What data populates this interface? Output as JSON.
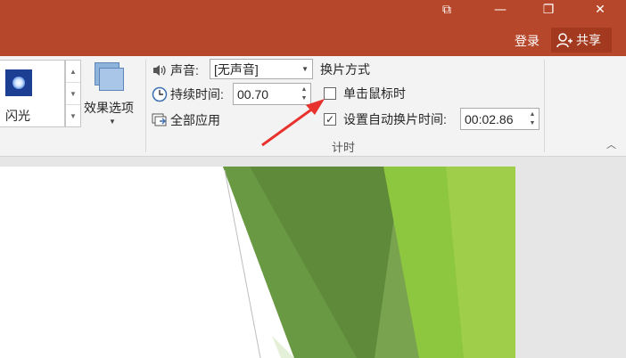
{
  "window_controls": {
    "restore_tab_glyph": "⧉",
    "minimize_glyph": "—",
    "maximize_glyph": "❐",
    "close_glyph": "✕"
  },
  "account": {
    "login": "登录",
    "share": "共享"
  },
  "transitions": {
    "selected_effect": "闪光",
    "effect_options": "效果选项"
  },
  "timing": {
    "sound_label": "声音:",
    "sound_value": "[无声音]",
    "duration_label": "持续时间:",
    "duration_value": "00.70",
    "apply_all": "全部应用",
    "advance_title": "换片方式",
    "on_click_label": "单击鼠标时",
    "on_click_checked": false,
    "after_label": "设置自动换片时间:",
    "after_checked": true,
    "after_value": "00:02.86",
    "group_label": "计时"
  },
  "colors": {
    "titlebar": "#b7472a",
    "share_bg": "#a33a20",
    "ribbon": "#f3f3f3",
    "arrow": "#e8322d",
    "slide_green_dark": "#5e8a3a",
    "slide_green_light": "#8dc63f"
  }
}
